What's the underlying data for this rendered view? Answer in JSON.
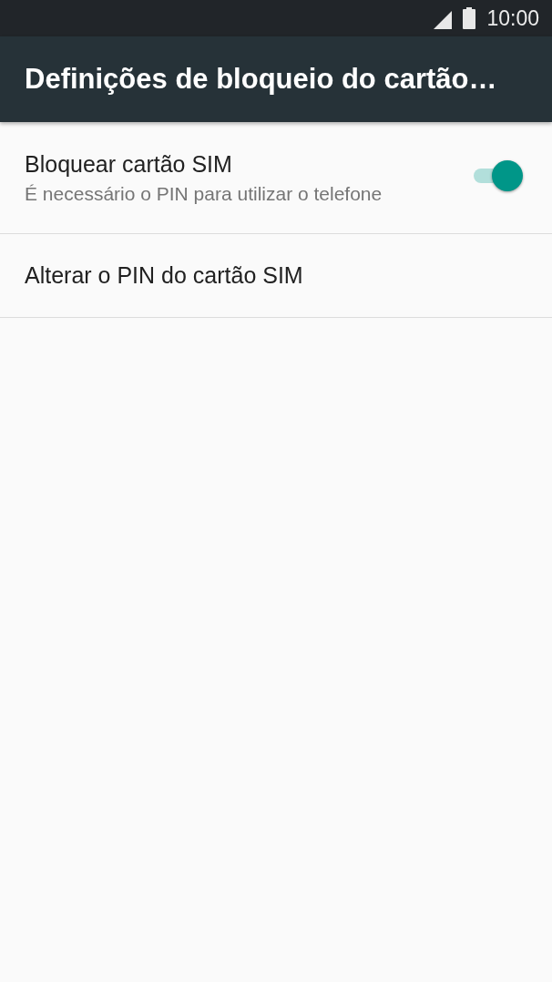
{
  "status_bar": {
    "time": "10:00"
  },
  "toolbar": {
    "title": "Definições de bloqueio do cartão…"
  },
  "settings": [
    {
      "kind": "switch",
      "title": "Bloquear cartão SIM",
      "summary": "É necessário o PIN para utilizar o telefone",
      "on": true
    },
    {
      "kind": "plain",
      "title": "Alterar o PIN do cartão SIM"
    }
  ]
}
